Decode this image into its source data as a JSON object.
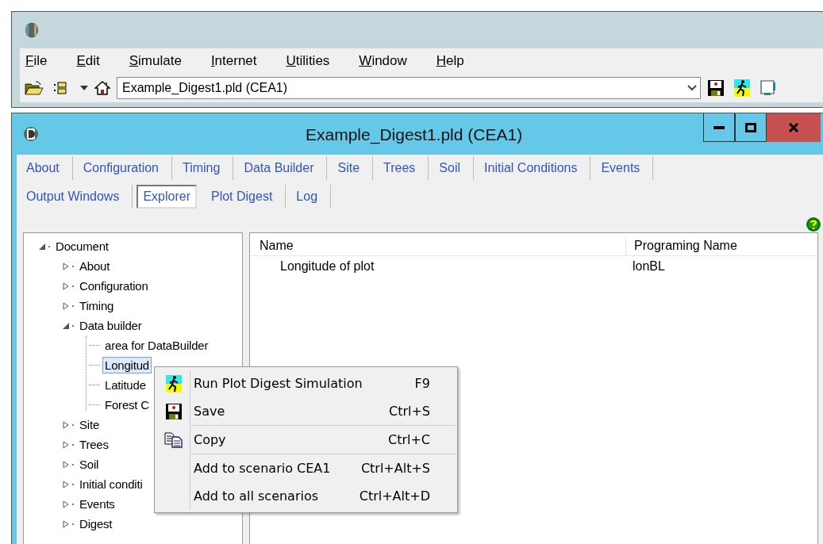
{
  "app": {
    "menu": [
      "File",
      "Edit",
      "Simulate",
      "Internet",
      "Utilities",
      "Window",
      "Help"
    ],
    "toolbar": {
      "document_combo": "Example_Digest1.pld (CEA1)"
    }
  },
  "document_window": {
    "title": "Example_Digest1.pld (CEA1)",
    "tab_rows": [
      [
        {
          "label": "About",
          "selected": false
        },
        {
          "label": "Configuration",
          "selected": false
        },
        {
          "label": "Timing",
          "selected": false
        },
        {
          "label": "Data Builder",
          "selected": false
        },
        {
          "label": "Site",
          "selected": false
        },
        {
          "label": "Trees",
          "selected": false
        },
        {
          "label": "Soil",
          "selected": false
        },
        {
          "label": "Initial Conditions",
          "selected": false
        },
        {
          "label": "Events",
          "selected": false
        }
      ],
      [
        {
          "label": "Output Windows",
          "selected": false
        },
        {
          "label": "Explorer",
          "selected": true
        },
        {
          "label": "Plot Digest",
          "selected": false
        },
        {
          "label": "Log",
          "selected": false
        }
      ]
    ],
    "tree": [
      {
        "label": "Document",
        "expanded": true,
        "selected": false,
        "children": [
          {
            "label": "About",
            "expanded": false,
            "selected": false
          },
          {
            "label": "Configuration",
            "expanded": false,
            "selected": false
          },
          {
            "label": "Timing",
            "expanded": false,
            "selected": false
          },
          {
            "label": "Data builder",
            "expanded": true,
            "selected": false,
            "children": [
              {
                "label": "area for DataBuilder",
                "selected": false
              },
              {
                "label": "Longitud",
                "selected": true
              },
              {
                "label": "Latitude",
                "selected": false
              },
              {
                "label": "Forest C",
                "selected": false
              }
            ]
          },
          {
            "label": "Site",
            "expanded": false,
            "selected": false
          },
          {
            "label": "Trees",
            "expanded": false,
            "selected": false
          },
          {
            "label": "Soil",
            "expanded": false,
            "selected": false
          },
          {
            "label": "Initial conditi",
            "expanded": false,
            "selected": false
          },
          {
            "label": "Events",
            "expanded": false,
            "selected": false
          },
          {
            "label": "Digest",
            "expanded": false,
            "selected": false
          }
        ]
      }
    ],
    "table": {
      "columns": [
        "Name",
        "Programing Name"
      ],
      "rows": [
        [
          "Longitude of plot",
          "lonBL"
        ]
      ]
    }
  },
  "context_menu": {
    "groups": [
      [
        {
          "label": "Run Plot Digest Simulation",
          "shortcut": "F9",
          "kind": "run"
        },
        {
          "label": "Save",
          "shortcut": "Ctrl+S",
          "kind": "save"
        }
      ],
      [
        {
          "label": "Copy",
          "shortcut": "Ctrl+C",
          "kind": "copy"
        }
      ],
      [
        {
          "label": "Add to scenario CEA1",
          "shortcut": "Ctrl+Alt+S",
          "kind": "plain"
        },
        {
          "label": "Add to all scenarios",
          "shortcut": "Ctrl+Alt+D",
          "kind": "plain"
        }
      ]
    ]
  }
}
